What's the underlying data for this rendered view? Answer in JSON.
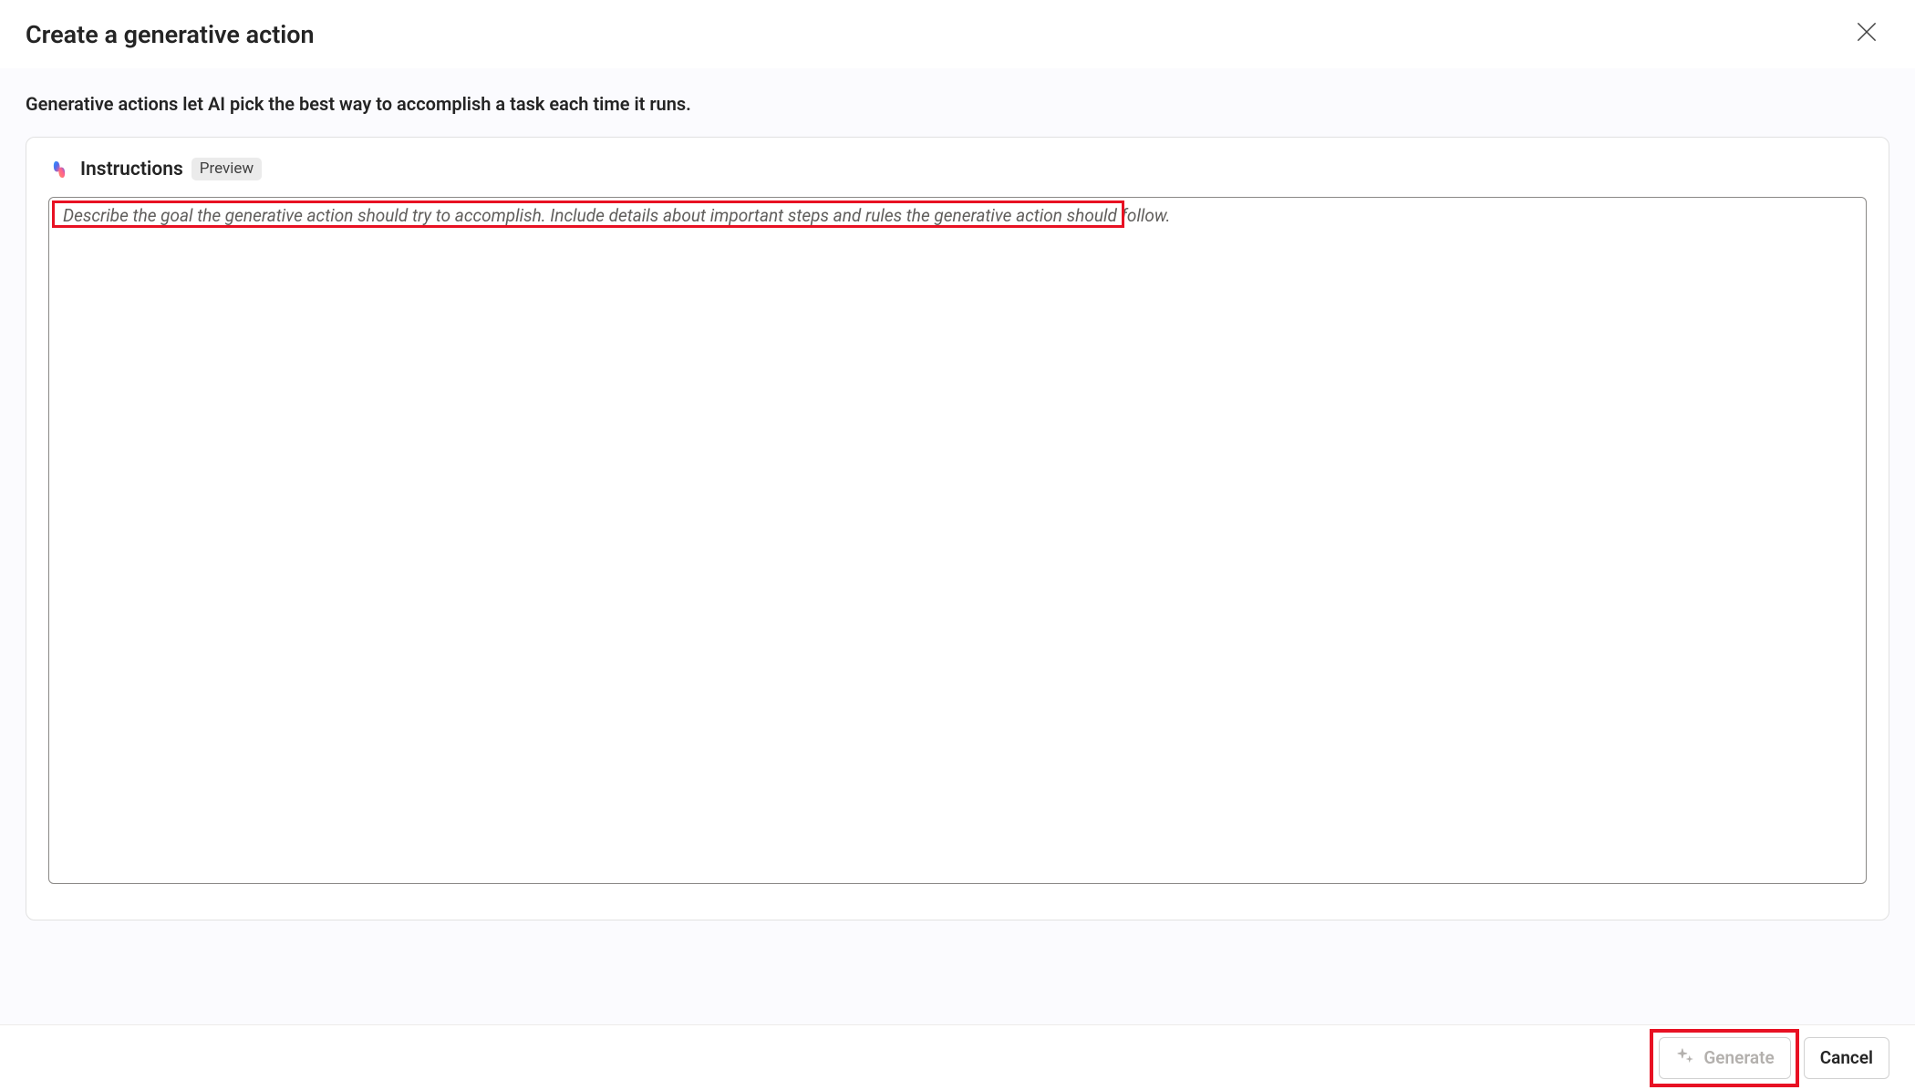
{
  "header": {
    "title": "Create a generative action"
  },
  "description": "Generative actions let AI pick the best way to accomplish a task each time it runs.",
  "section": {
    "title": "Instructions",
    "badge": "Preview"
  },
  "textarea": {
    "placeholder": "Describe the goal the generative action should try to accomplish. Include details about important steps and rules the generative action should follow.",
    "value": ""
  },
  "footer": {
    "generate_label": "Generate",
    "cancel_label": "Cancel"
  }
}
